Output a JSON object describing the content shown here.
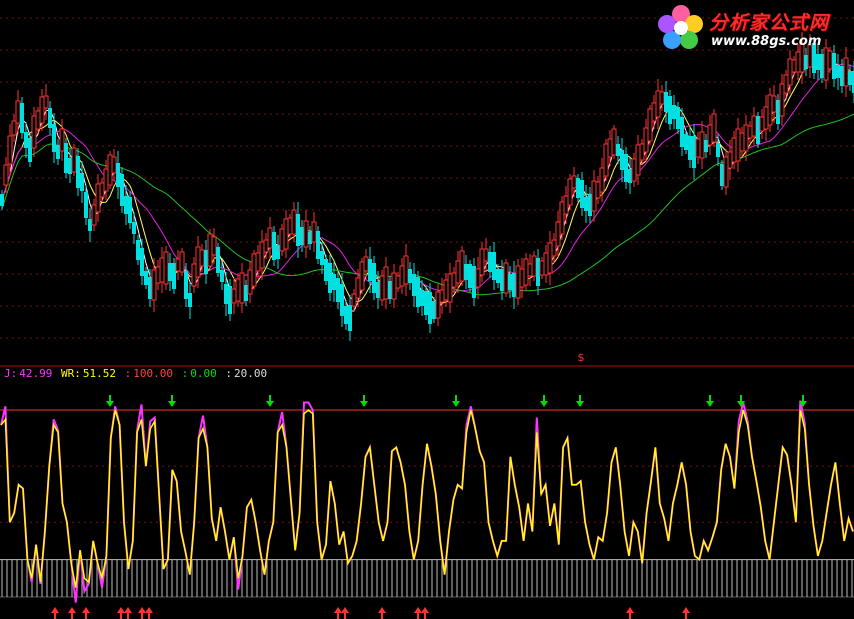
{
  "chart_data": [
    {
      "type": "candlestick",
      "title": "",
      "up_color": "#ff3333",
      "down_color": "#00e0e0",
      "moving_averages": [
        {
          "color": "#ffffff"
        },
        {
          "color": "#ffff66"
        },
        {
          "color": "#e020e0"
        },
        {
          "color": "#20c020"
        }
      ],
      "marker": "$",
      "marker_color": "#ff3333"
    },
    {
      "type": "line",
      "legend": {
        "j_label": "J:",
        "j_value": "42.99",
        "wr_label": "WR:",
        "wr_value": "51.52",
        "upper_label": ":",
        "upper_value": "100.00",
        "mid_label": ":",
        "mid_value": "0.00",
        "lower_label": ":",
        "lower_value": "20.00"
      },
      "reference_lines": [
        100,
        20,
        0
      ],
      "series": [
        {
          "color": "#ff33ff"
        },
        {
          "color": "#ffff00"
        }
      ],
      "sell_signal_color": "#00dd00",
      "buy_signal_color": "#ff3333"
    }
  ],
  "logo": {
    "text": "分析家公式网",
    "url": "www.88gs.com"
  },
  "colors": {
    "background": "#000000",
    "grid": "#7a1010",
    "divider": "#b01010"
  }
}
